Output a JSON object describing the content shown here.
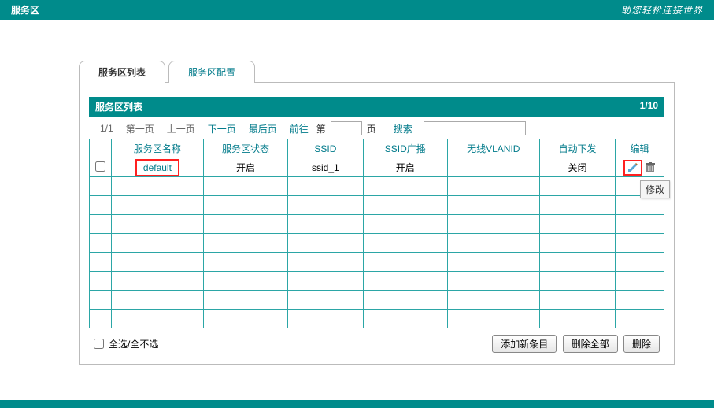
{
  "header": {
    "title": "服务区",
    "slogan": "助您轻松连接世界"
  },
  "tabs": {
    "list": "服务区列表",
    "config": "服务区配置"
  },
  "listPanel": {
    "title": "服务区列表",
    "pageIndicator": "1/10"
  },
  "pager": {
    "pos": "1/1",
    "first": "第一页",
    "prev": "上一页",
    "next": "下一页",
    "last": "最后页",
    "goto": "前往",
    "pagePrefix": "第",
    "pageSuffix": "页",
    "search": "搜索"
  },
  "columns": {
    "name": "服务区名称",
    "status": "服务区状态",
    "ssid": "SSID",
    "ssidBroadcast": "SSID广播",
    "vlan": "无线VLANID",
    "autoDeliver": "自动下发",
    "edit": "编辑"
  },
  "rows": [
    {
      "name": "default",
      "status": "开启",
      "ssid": "ssid_1",
      "ssidBroadcast": "开启",
      "vlan": "",
      "autoDeliver": "关闭"
    }
  ],
  "tooltip": {
    "edit": "修改"
  },
  "footer": {
    "selectAll": "全选/全不选",
    "add": "添加新条目",
    "deleteAll": "删除全部",
    "delete": "删除"
  }
}
